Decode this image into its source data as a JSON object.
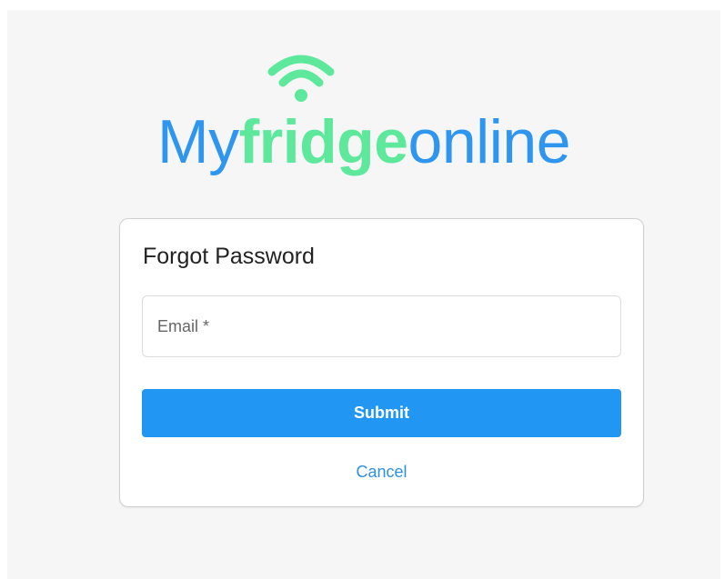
{
  "brand": {
    "part1": "My",
    "part2": "fridge",
    "part3": "online",
    "colors": {
      "blue": "#2f96ef",
      "green": "#5ee89c"
    },
    "icon": "wifi-icon"
  },
  "card": {
    "title": "Forgot Password",
    "email": {
      "placeholder": "Email *",
      "value": ""
    },
    "submit_label": "Submit",
    "cancel_label": "Cancel"
  },
  "colors": {
    "primary": "#2196f3",
    "background": "#f6f6f6",
    "card": "#ffffff"
  }
}
